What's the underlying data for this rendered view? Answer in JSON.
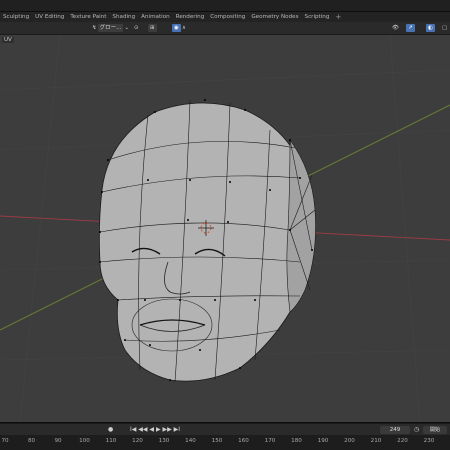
{
  "workspace_tabs": [
    "Sculpting",
    "UV Editing",
    "Texture Paint",
    "Shading",
    "Animation",
    "Rendering",
    "Compositing",
    "Geometry Nodes",
    "Scripting"
  ],
  "add_tab_symbol": "+",
  "header": {
    "mode_label": "UV",
    "transform_orientation": "グロー...",
    "pivot_symbol": "⊙",
    "snap_symbol": "⊞",
    "proportional_symbol": "∧"
  },
  "timeline": {
    "current_frame": "249",
    "end_label": "開始",
    "record_symbol": "●",
    "playback_symbols": "I◀ ◀◀ ◀ ▶ ▶▶ ▶I"
  },
  "ruler_ticks": [
    "70",
    "80",
    "90",
    "100",
    "110",
    "120",
    "130",
    "140",
    "150",
    "160",
    "170",
    "180",
    "190",
    "200",
    "210",
    "220",
    "230",
    "240"
  ],
  "colors": {
    "viewport_bg": "#3d3d3d",
    "x_axis": "#9a3c45",
    "y_axis": "#6b8a3a",
    "mesh_fill": "#b3b3b3",
    "wire": "#1a1a1a",
    "cursor": "#e04a2a"
  }
}
